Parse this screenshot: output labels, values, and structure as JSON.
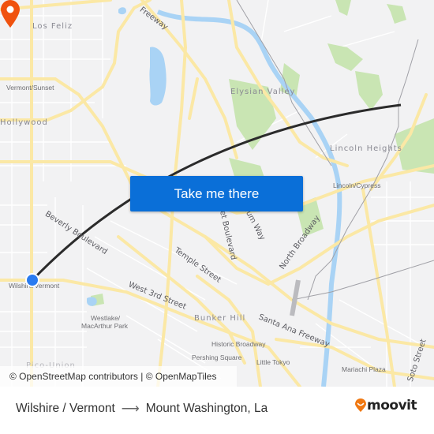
{
  "map": {
    "neighborhoods": [
      {
        "id": "los-feliz",
        "label": "Los Feliz"
      },
      {
        "id": "hollywood",
        "label": "Hollywood"
      },
      {
        "id": "elysian-valley",
        "label": "Elysian Valley"
      },
      {
        "id": "lincoln-heights",
        "label": "Lincoln Heights"
      },
      {
        "id": "bunker-hill",
        "label": "Bunker Hill"
      },
      {
        "id": "pico-union",
        "label": "Pico-Union"
      }
    ],
    "stations": [
      {
        "id": "vermont-sunset",
        "label": "Vermont/Sunset"
      },
      {
        "id": "wilshire-vermont",
        "label": "Wilshire/Vermont"
      },
      {
        "id": "westlake-1",
        "label": "Westlake/"
      },
      {
        "id": "westlake-2",
        "label": "MacArthur Park"
      },
      {
        "id": "lincoln-cypress",
        "label": "Lincoln/Cypress"
      },
      {
        "id": "historic-broadway",
        "label": "Historic Broadway"
      },
      {
        "id": "pershing-square",
        "label": "Pershing Square"
      },
      {
        "id": "little-tokyo",
        "label": "Little Tokyo"
      },
      {
        "id": "mariachi-plaza",
        "label": "Mariachi Plaza"
      }
    ],
    "streets": [
      {
        "id": "freeway-top",
        "label": "Freeway"
      },
      {
        "id": "beverly",
        "label": "Beverly Boulevard"
      },
      {
        "id": "temple",
        "label": "Temple Street"
      },
      {
        "id": "sunset",
        "label": "Sunset Boulevard"
      },
      {
        "id": "stadium",
        "label": "Stadium Way"
      },
      {
        "id": "north-broadway",
        "label": "North Broadway"
      },
      {
        "id": "west-3rd",
        "label": "West 3rd Street"
      },
      {
        "id": "santa-ana",
        "label": "Santa Ana Freeway"
      },
      {
        "id": "soto",
        "label": "Soto Street"
      }
    ],
    "attribution": "© OpenStreetMap contributors | © OpenMapTiles",
    "cta_label": "Take me there",
    "colors": {
      "route": "#2b2b2b",
      "origin": "#2a7bf0",
      "destination": "#f0520f",
      "button": "#0a6fd8",
      "water": "#a9d3f5",
      "park": "#c9e5b3",
      "road_major": "#fbe8a5"
    }
  },
  "footer": {
    "origin": "Wilshire / Vermont",
    "arrow_icon": "arrow-right-icon",
    "destination": "Mount Washington, La",
    "brand": "moovit"
  }
}
